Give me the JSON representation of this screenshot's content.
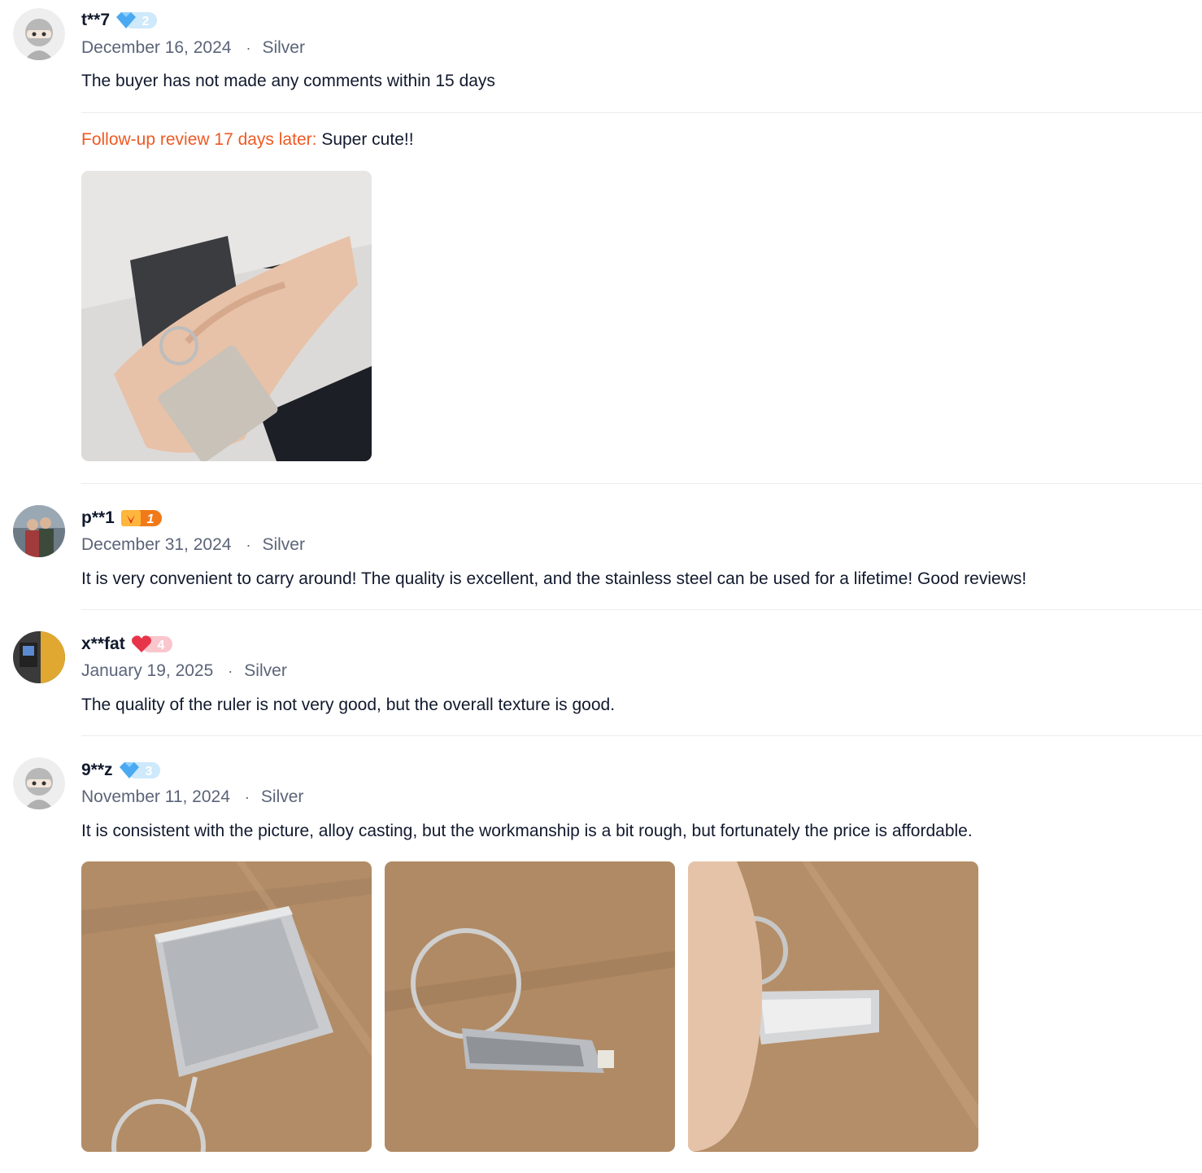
{
  "reviews": [
    {
      "username": "t**7",
      "badge": {
        "icon": "diamond-badge-icon",
        "level": "2",
        "color": "#5bb6f5"
      },
      "date": "December 16, 2024",
      "separator": "·",
      "variant": "Silver",
      "comment": "The buyer has not made any comments within 15 days",
      "followup": {
        "label": "Follow-up review 17 days later:",
        "text": "Super cute!!"
      },
      "photos": [
        "hand-holding-keychain-photo"
      ]
    },
    {
      "username": "p**1",
      "badge": {
        "icon": "crown-badge-icon",
        "level": "1",
        "color": "#f07a1a"
      },
      "date": "December 31, 2024",
      "separator": "·",
      "variant": "Silver",
      "comment": "It is very convenient to carry around! The quality is excellent, and the stainless steel can be used for a lifetime! Good reviews!"
    },
    {
      "username": "x**fat",
      "badge": {
        "icon": "heart-badge-icon",
        "level": "4",
        "color": "#f05a6a"
      },
      "date": "January 19, 2025",
      "separator": "·",
      "variant": "Silver",
      "comment": "The quality of the ruler is not very good, but the overall texture is good."
    },
    {
      "username": "9**z",
      "badge": {
        "icon": "diamond-badge-icon",
        "level": "3",
        "color": "#5bb6f5"
      },
      "date": "November 11, 2024",
      "separator": "·",
      "variant": "Silver",
      "comment": "It is consistent with the picture, alloy casting, but the workmanship is a bit rough, but fortunately the price is affordable.",
      "photos": [
        "tape-measure-top-photo",
        "tape-measure-side-photo",
        "tape-measure-held-photo"
      ]
    }
  ]
}
